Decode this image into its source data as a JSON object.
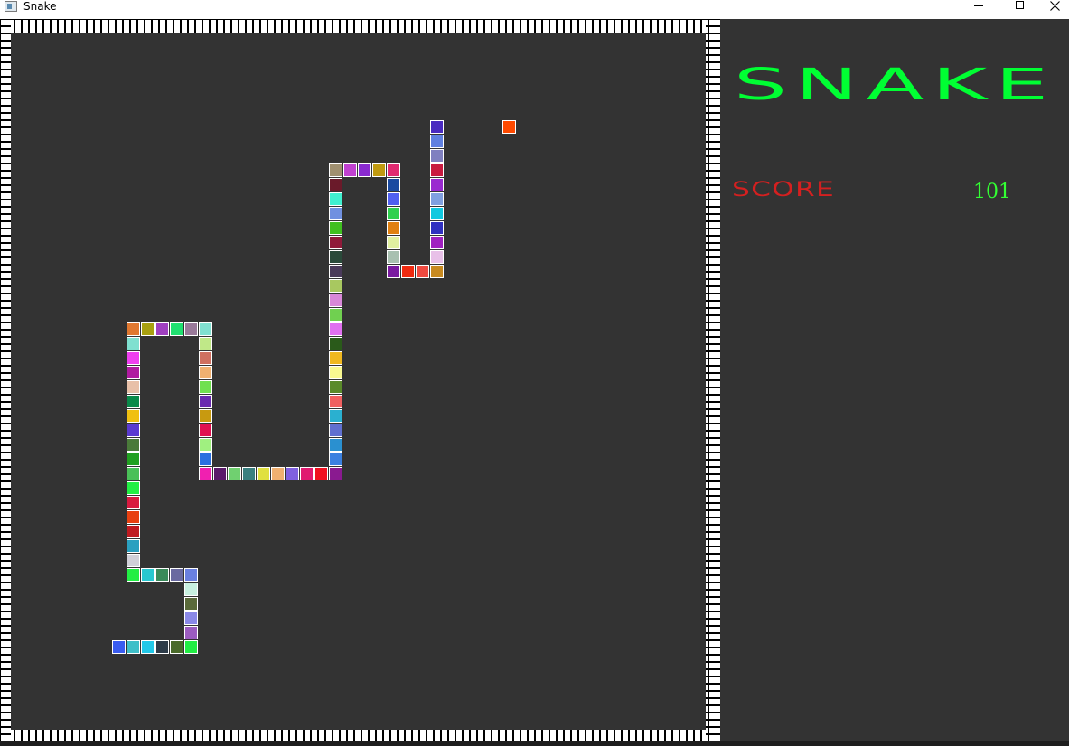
{
  "window": {
    "title": "Snake",
    "minimize_icon": "minimize-icon",
    "maximize_icon": "maximize-icon",
    "close_icon": "close-icon"
  },
  "colors": {
    "background": "#333333",
    "title": "#00ff33",
    "score_label": "#d42020",
    "score_value": "#33ff33",
    "food": "#ff4a00"
  },
  "panel": {
    "title": "SNAKE",
    "score_label": "SCORE",
    "score_value": "101"
  },
  "game": {
    "grid_cols": 49,
    "grid_rows": 50,
    "food": {
      "col": 34,
      "row": 7,
      "color": "#ff4a00"
    },
    "snake": [
      {
        "col": 7,
        "row": 43,
        "color": "#3a5cf0"
      },
      {
        "col": 8,
        "row": 43,
        "color": "#3fbfc8"
      },
      {
        "col": 9,
        "row": 43,
        "color": "#22c8e8"
      },
      {
        "col": 10,
        "row": 43,
        "color": "#2d3b48"
      },
      {
        "col": 11,
        "row": 43,
        "color": "#4a6a2a"
      },
      {
        "col": 12,
        "row": 43,
        "color": "#22ee44"
      },
      {
        "col": 12,
        "row": 42,
        "color": "#9b5cc0"
      },
      {
        "col": 12,
        "row": 41,
        "color": "#8a88e8"
      },
      {
        "col": 12,
        "row": 40,
        "color": "#5a6a3a"
      },
      {
        "col": 12,
        "row": 39,
        "color": "#c8f0e0"
      },
      {
        "col": 12,
        "row": 38,
        "color": "#6a80e0"
      },
      {
        "col": 11,
        "row": 38,
        "color": "#6a6aa0"
      },
      {
        "col": 10,
        "row": 38,
        "color": "#3a8a5a"
      },
      {
        "col": 9,
        "row": 38,
        "color": "#28c8d0"
      },
      {
        "col": 8,
        "row": 38,
        "color": "#22ee44"
      },
      {
        "col": 8,
        "row": 37,
        "color": "#d0d0d8"
      },
      {
        "col": 8,
        "row": 36,
        "color": "#2aa0c0"
      },
      {
        "col": 8,
        "row": 35,
        "color": "#c01a20"
      },
      {
        "col": 8,
        "row": 34,
        "color": "#e84010"
      },
      {
        "col": 8,
        "row": 33,
        "color": "#d81a40"
      },
      {
        "col": 8,
        "row": 32,
        "color": "#22ee44"
      },
      {
        "col": 8,
        "row": 31,
        "color": "#4ac058"
      },
      {
        "col": 8,
        "row": 30,
        "color": "#20a020"
      },
      {
        "col": 8,
        "row": 29,
        "color": "#4a7a3a"
      },
      {
        "col": 8,
        "row": 28,
        "color": "#5a3ad0"
      },
      {
        "col": 8,
        "row": 27,
        "color": "#f0c010"
      },
      {
        "col": 8,
        "row": 26,
        "color": "#0a8a4a"
      },
      {
        "col": 8,
        "row": 25,
        "color": "#e8c0a8"
      },
      {
        "col": 8,
        "row": 24,
        "color": "#b01aa0"
      },
      {
        "col": 8,
        "row": 23,
        "color": "#f040f0"
      },
      {
        "col": 8,
        "row": 22,
        "color": "#80e0d0"
      },
      {
        "col": 8,
        "row": 21,
        "color": "#e07830"
      },
      {
        "col": 9,
        "row": 21,
        "color": "#a8a010"
      },
      {
        "col": 10,
        "row": 21,
        "color": "#a040c0"
      },
      {
        "col": 11,
        "row": 21,
        "color": "#20e070"
      },
      {
        "col": 12,
        "row": 21,
        "color": "#9a7a9a"
      },
      {
        "col": 13,
        "row": 21,
        "color": "#80e0d0"
      },
      {
        "col": 13,
        "row": 22,
        "color": "#c0e888"
      },
      {
        "col": 13,
        "row": 23,
        "color": "#d07060"
      },
      {
        "col": 13,
        "row": 24,
        "color": "#f0b070"
      },
      {
        "col": 13,
        "row": 25,
        "color": "#70e050"
      },
      {
        "col": 13,
        "row": 26,
        "color": "#6a2ab0"
      },
      {
        "col": 13,
        "row": 27,
        "color": "#c89a10"
      },
      {
        "col": 13,
        "row": 28,
        "color": "#e01050"
      },
      {
        "col": 13,
        "row": 29,
        "color": "#a0f080"
      },
      {
        "col": 13,
        "row": 30,
        "color": "#2a70e0"
      },
      {
        "col": 13,
        "row": 31,
        "color": "#f020b0"
      },
      {
        "col": 14,
        "row": 31,
        "color": "#5a1a6a"
      },
      {
        "col": 15,
        "row": 31,
        "color": "#70d070"
      },
      {
        "col": 16,
        "row": 31,
        "color": "#3a8080"
      },
      {
        "col": 17,
        "row": 31,
        "color": "#e0e040"
      },
      {
        "col": 18,
        "row": 31,
        "color": "#f0b070"
      },
      {
        "col": 19,
        "row": 31,
        "color": "#8060e0"
      },
      {
        "col": 20,
        "row": 31,
        "color": "#e01a70"
      },
      {
        "col": 21,
        "row": 31,
        "color": "#f01020"
      },
      {
        "col": 22,
        "row": 31,
        "color": "#8a1a90"
      },
      {
        "col": 22,
        "row": 30,
        "color": "#3a80e0"
      },
      {
        "col": 22,
        "row": 29,
        "color": "#2a90d0"
      },
      {
        "col": 22,
        "row": 28,
        "color": "#6070d0"
      },
      {
        "col": 22,
        "row": 27,
        "color": "#2ab0d0"
      },
      {
        "col": 22,
        "row": 26,
        "color": "#f06060"
      },
      {
        "col": 22,
        "row": 25,
        "color": "#5a8a2a"
      },
      {
        "col": 22,
        "row": 24,
        "color": "#f8f890"
      },
      {
        "col": 22,
        "row": 23,
        "color": "#f0b820"
      },
      {
        "col": 22,
        "row": 22,
        "color": "#2a5a1a"
      },
      {
        "col": 22,
        "row": 21,
        "color": "#e070f0"
      },
      {
        "col": 22,
        "row": 20,
        "color": "#70d050"
      },
      {
        "col": 22,
        "row": 19,
        "color": "#d888d8"
      },
      {
        "col": 22,
        "row": 18,
        "color": "#a8c860"
      },
      {
        "col": 22,
        "row": 17,
        "color": "#4a3a5a"
      },
      {
        "col": 22,
        "row": 16,
        "color": "#2a4a3a"
      },
      {
        "col": 22,
        "row": 15,
        "color": "#901a3a"
      },
      {
        "col": 22,
        "row": 14,
        "color": "#40c020"
      },
      {
        "col": 22,
        "row": 13,
        "color": "#7090e0"
      },
      {
        "col": 22,
        "row": 12,
        "color": "#40f0d0"
      },
      {
        "col": 22,
        "row": 11,
        "color": "#6a1a2a"
      },
      {
        "col": 22,
        "row": 10,
        "color": "#a09070"
      },
      {
        "col": 23,
        "row": 10,
        "color": "#c040d0"
      },
      {
        "col": 24,
        "row": 10,
        "color": "#8a2ad0"
      },
      {
        "col": 25,
        "row": 10,
        "color": "#c09a10"
      },
      {
        "col": 26,
        "row": 10,
        "color": "#e02a70"
      },
      {
        "col": 26,
        "row": 11,
        "color": "#1a4aa0"
      },
      {
        "col": 26,
        "row": 12,
        "color": "#5060f0"
      },
      {
        "col": 26,
        "row": 13,
        "color": "#30d050"
      },
      {
        "col": 26,
        "row": 14,
        "color": "#e08010"
      },
      {
        "col": 26,
        "row": 15,
        "color": "#e0f0a0"
      },
      {
        "col": 26,
        "row": 16,
        "color": "#a8c0b0"
      },
      {
        "col": 26,
        "row": 17,
        "color": "#7a1aa0"
      },
      {
        "col": 27,
        "row": 17,
        "color": "#f02a10"
      },
      {
        "col": 28,
        "row": 17,
        "color": "#f04a40"
      },
      {
        "col": 29,
        "row": 17,
        "color": "#c88a20"
      },
      {
        "col": 29,
        "row": 16,
        "color": "#e8c0e8"
      },
      {
        "col": 29,
        "row": 15,
        "color": "#a020c0"
      },
      {
        "col": 29,
        "row": 14,
        "color": "#3030c0"
      },
      {
        "col": 29,
        "row": 13,
        "color": "#10c8e0"
      },
      {
        "col": 29,
        "row": 12,
        "color": "#80a0e0"
      },
      {
        "col": 29,
        "row": 11,
        "color": "#9a2ad0"
      },
      {
        "col": 29,
        "row": 10,
        "color": "#c81a40"
      },
      {
        "col": 29,
        "row": 9,
        "color": "#8080c0"
      },
      {
        "col": 29,
        "row": 8,
        "color": "#6080e0"
      },
      {
        "col": 29,
        "row": 7,
        "color": "#4a2ac0"
      }
    ]
  }
}
